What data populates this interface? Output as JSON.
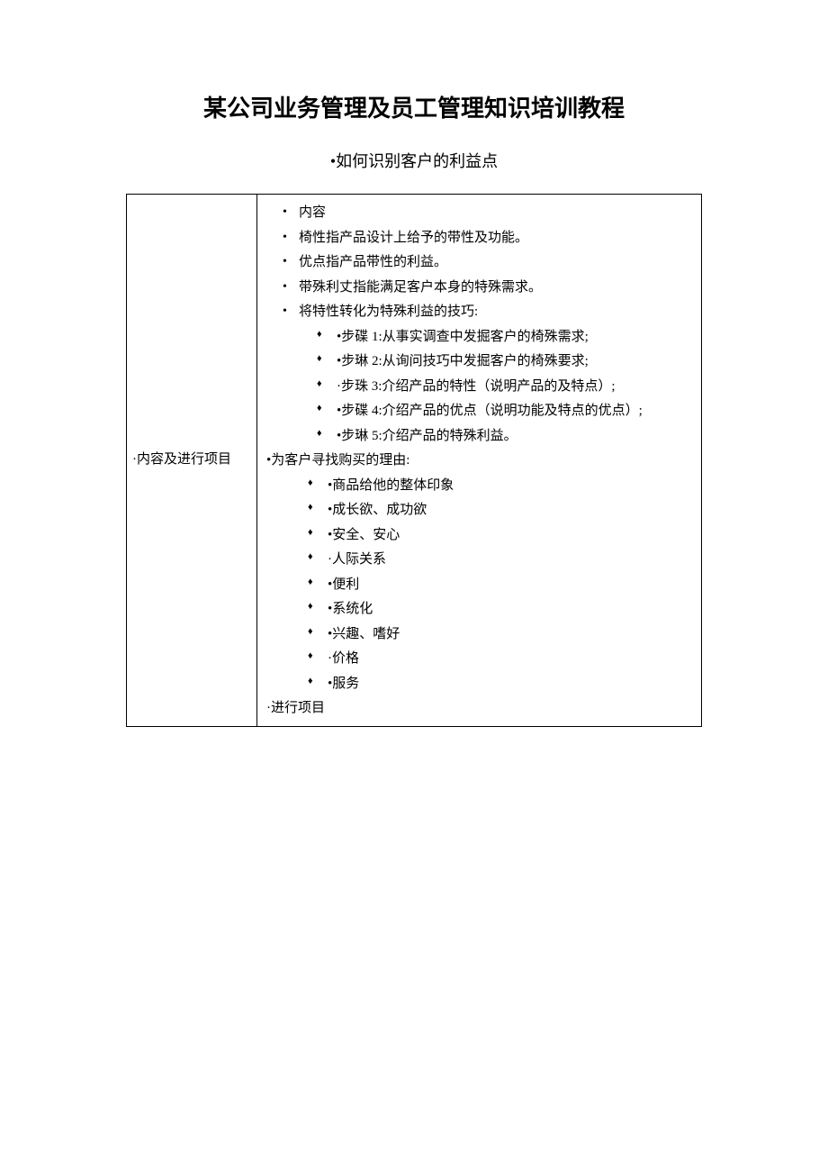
{
  "title": "某公司业务管理及员工管理知识培训教程",
  "subtitle": "•如何识别客户的利益点",
  "leftCell": "·内容及进行项目",
  "content": {
    "bullets": [
      "内容",
      "椅性指产品设计上给予的带性及功能。",
      "优点指产品带性的利益。",
      "带殊利丈指能满足客户本身的特殊需求。",
      "将特性转化为特殊利益的技巧:"
    ],
    "steps": [
      "•步碟 1:从事实调查中发掘客户的椅殊需求;",
      "•步琳 2:从询问技巧中发掘客户的椅殊要求;",
      "·步珠 3:介绍产品的特性（说明产品的及特点）;",
      "•步碟 4:介绍产品的优点（说明功能及特点的优点）;",
      "•步琳 5:介绍产品的特殊利益。"
    ],
    "reasonTitle": "•为客户寻找购买的理由:",
    "reasons": [
      "•商品给他的整体印象",
      "•成长欲、成功欲",
      "•安全、安心",
      "·人际关系",
      "•便利",
      "•系统化",
      "•兴趣、嗜好",
      "·价格",
      "•服务"
    ],
    "footer": "·进行项目"
  }
}
